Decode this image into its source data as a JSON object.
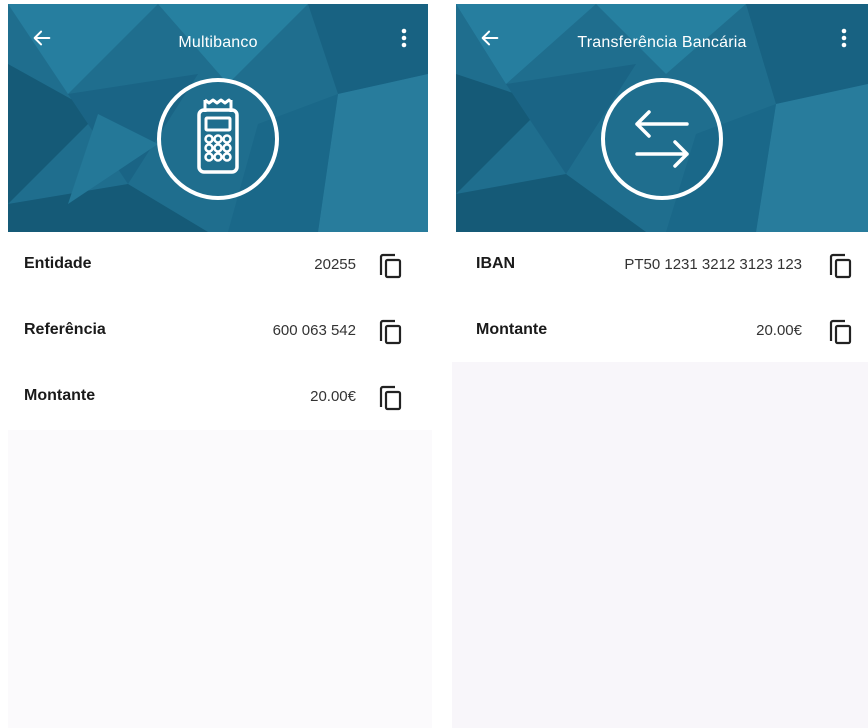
{
  "colors": {
    "header_base": "#1f6e8e",
    "header_dark": "#155a77",
    "header_light": "#2a85a6",
    "text": "#1a1a1a",
    "icon_white": "#ffffff"
  },
  "multibanco": {
    "title": "Multibanco",
    "back_icon": "arrow-left-icon",
    "menu_icon": "more-vertical-icon",
    "emblem_icon": "payment-terminal-icon",
    "rows": [
      {
        "label": "Entidade",
        "value": "20255"
      },
      {
        "label": "Referência",
        "value": "600 063 542"
      },
      {
        "label": "Montante",
        "value": "20.00€"
      }
    ]
  },
  "transferencia": {
    "title": "Transferência Bancária",
    "back_icon": "arrow-left-icon",
    "menu_icon": "more-vertical-icon",
    "emblem_icon": "transfer-arrows-icon",
    "rows": [
      {
        "label": "IBAN",
        "value": "PT50 1231 3212 3123 123"
      },
      {
        "label": "Montante",
        "value": "20.00€"
      }
    ]
  }
}
